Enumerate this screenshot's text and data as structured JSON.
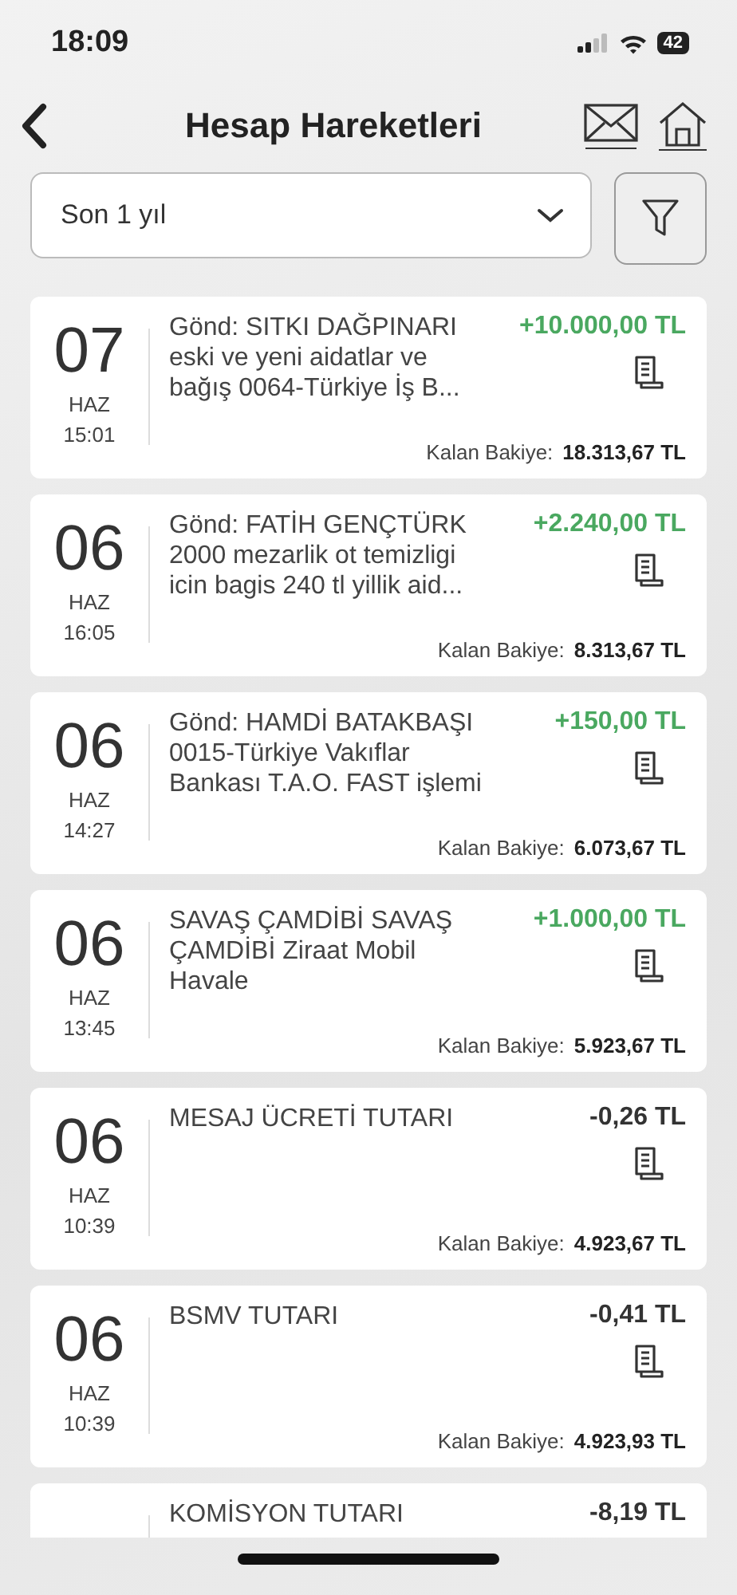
{
  "status_bar": {
    "time": "18:09",
    "battery": "42"
  },
  "header": {
    "title": "Hesap Hareketleri"
  },
  "period_select": {
    "value": "Son 1 yıl"
  },
  "transactions": [
    {
      "day": "07",
      "month": "HAZ",
      "time": "15:01",
      "description": "Gönd: SITKI DAĞPINARI eski ve yeni aidatlar ve bağış 0064-Türkiye İş B...",
      "amount": "+10.000,00 TL",
      "kind": "credit",
      "balance_label": "Kalan Bakiye:",
      "balance": "18.313,67 TL"
    },
    {
      "day": "06",
      "month": "HAZ",
      "time": "16:05",
      "description": "Gönd: FATİH GENÇTÜRK 2000 mezarlik ot temizligi icin bagis 240 tl yillik aid...",
      "amount": "+2.240,00 TL",
      "kind": "credit",
      "balance_label": "Kalan Bakiye:",
      "balance": "8.313,67 TL"
    },
    {
      "day": "06",
      "month": "HAZ",
      "time": "14:27",
      "description": "Gönd: HAMDİ BATAKBAŞI 0015-Türkiye Vakıflar Bankası T.A.O. FAST işlemi",
      "amount": "+150,00 TL",
      "kind": "credit",
      "balance_label": "Kalan Bakiye:",
      "balance": "6.073,67 TL"
    },
    {
      "day": "06",
      "month": "HAZ",
      "time": "13:45",
      "description": "SAVAŞ ÇAMDİBİ SAVAŞ ÇAMDİBİ Ziraat Mobil Havale",
      "amount": "+1.000,00 TL",
      "kind": "credit",
      "balance_label": "Kalan Bakiye:",
      "balance": "5.923,67 TL"
    },
    {
      "day": "06",
      "month": "HAZ",
      "time": "10:39",
      "description": "MESAJ ÜCRETİ TUTARI",
      "amount": "-0,26 TL",
      "kind": "debit",
      "balance_label": "Kalan Bakiye:",
      "balance": "4.923,67 TL"
    },
    {
      "day": "06",
      "month": "HAZ",
      "time": "10:39",
      "description": "BSMV TUTARI",
      "amount": "-0,41 TL",
      "kind": "debit",
      "balance_label": "Kalan Bakiye:",
      "balance": "4.923,93 TL"
    },
    {
      "description": "KOMİSYON TUTARI",
      "amount": "-8,19 TL",
      "kind": "debit"
    }
  ]
}
